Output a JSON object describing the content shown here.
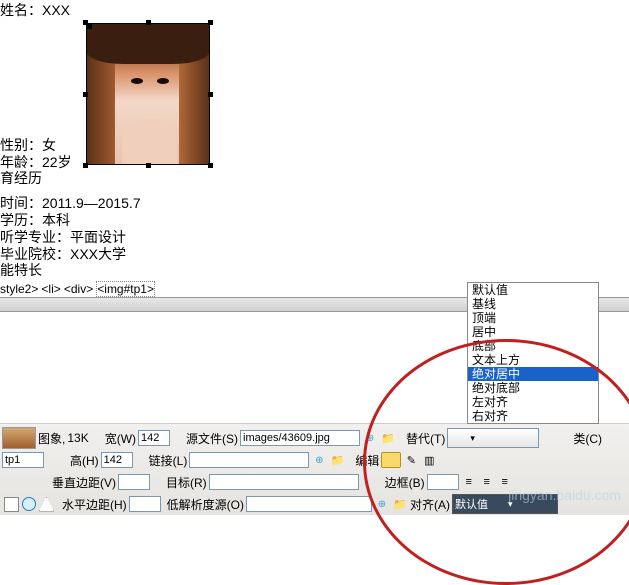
{
  "doc": {
    "name_label": "姓名：",
    "name_value": "XXX",
    "gender_label": "性别：",
    "gender_value": "女",
    "age_label": "年龄：",
    "age_value": "22岁",
    "section_edu": "育经历",
    "time_label": "时间：",
    "time_value": "2011.9—2015.7",
    "degree_label": "学历：",
    "degree_value": "本科",
    "major_label": "听学专业：",
    "major_value": "平面设计",
    "school_label": "毕业院校：",
    "school_value": "XXX大学",
    "section_skill": "能特长"
  },
  "breadcrumb": {
    "b1": "style2>",
    "b2": "<li>",
    "b3": "<div>",
    "b4": "<img#tp1>"
  },
  "props": {
    "img_label": "图象,",
    "size": "13K",
    "width_label": "宽(W)",
    "width_val": "142",
    "height_label": "高(H)",
    "height_val": "142",
    "src_label": "源文件(S)",
    "src_val": "images/43609.jpg",
    "link_label": "链接(L)",
    "link_val": "",
    "id_val": "tp1",
    "alt_label": "替代(T)",
    "edit_label": "编辑",
    "class_label": "类(C)",
    "vspace_label": "垂直边距(V)",
    "hspace_label": "水平边距(H)",
    "target_label": "目标(R)",
    "lowsrc_label": "低解析度源(O)",
    "border_label": "边框(B)",
    "align_label": "对齐(A)",
    "align_val": "默认值"
  },
  "dropdown": {
    "o1": "默认值",
    "o2": "基线",
    "o3": "顶端",
    "o4": "居中",
    "o5": "底部",
    "o6": "文本上方",
    "o7": "绝对居中",
    "o8": "绝对底部",
    "o9": "左对齐",
    "o10": "右对齐"
  }
}
